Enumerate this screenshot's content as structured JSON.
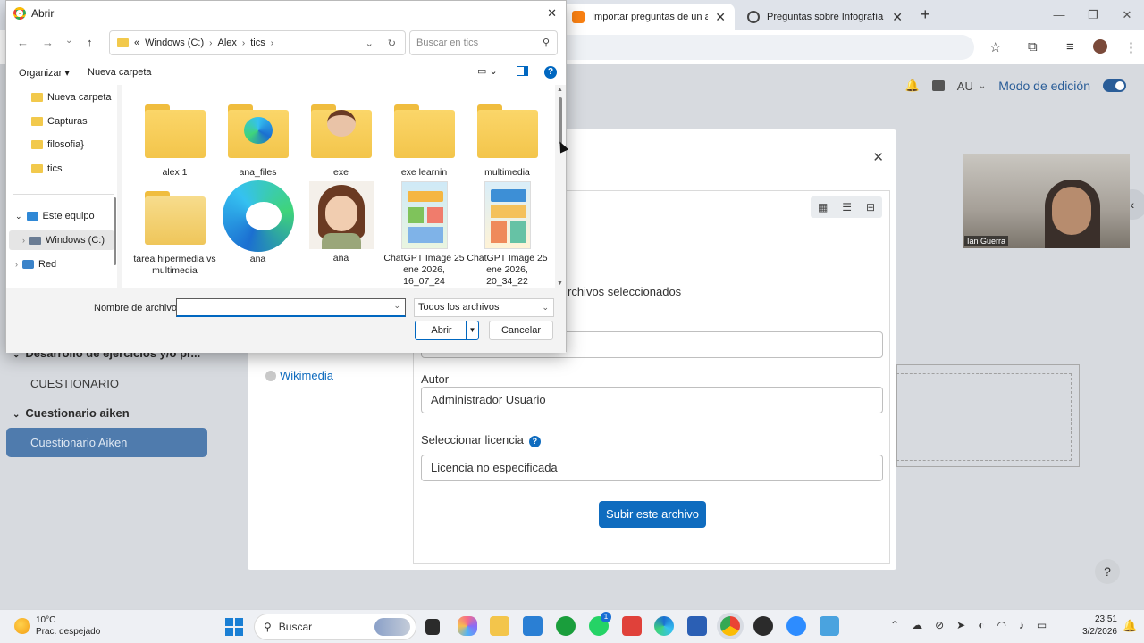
{
  "browser": {
    "tabs": [
      {
        "label": "Importar preguntas de un archi",
        "active": true
      },
      {
        "label": "Preguntas sobre Infografía",
        "active": false
      }
    ],
    "new_tab": "+",
    "window_controls": [
      "—",
      "❐",
      "✕"
    ]
  },
  "moodle": {
    "header": {
      "user_initials": "AU",
      "edit_mode_label": "Modo de edición"
    },
    "nav": {
      "section1": "Desarrollo de ejercicios y/o pr...",
      "item1": "CUESTIONARIO",
      "section2": "Cuestionario aiken",
      "active_item": "Cuestionario Aiken"
    },
    "file_picker": {
      "partial_text": "rchivos seleccionados",
      "repo_wikimedia": "Wikimedia",
      "author_label": "Autor",
      "author_value": "Administrador Usuario",
      "license_label": "Seleccionar licencia",
      "license_help": "?",
      "license_value": "Licencia no especificada",
      "upload_button": "Subir este archivo"
    },
    "video_name": "Ian Guerra",
    "help": "?"
  },
  "dialog": {
    "title": "Abrir",
    "breadcrumb": [
      "«",
      "Windows (C:)",
      "Alex",
      "tics"
    ],
    "search_placeholder": "Buscar en tics",
    "commands": {
      "organize": "Organizar ▾",
      "new_folder": "Nueva carpeta",
      "help": "?"
    },
    "tree": [
      {
        "label": "Nueva carpeta",
        "type": "folder"
      },
      {
        "label": "Capturas",
        "type": "folder"
      },
      {
        "label": "filosofia}",
        "type": "folder"
      },
      {
        "label": "tics",
        "type": "folder"
      },
      {
        "label": "Este equipo",
        "type": "pc"
      },
      {
        "label": "Windows (C:)",
        "type": "drive",
        "selected": true
      },
      {
        "label": "Red",
        "type": "network"
      }
    ],
    "files": [
      {
        "name": "alex 1",
        "kind": "folder"
      },
      {
        "name": "ana_files",
        "kind": "folder-edge"
      },
      {
        "name": "exe",
        "kind": "folder-avatar"
      },
      {
        "name": "exe learnin",
        "kind": "folder"
      },
      {
        "name": "multimedia",
        "kind": "folder"
      },
      {
        "name": "tarea hipermedia vs multimedia",
        "kind": "folder-open"
      },
      {
        "name": "ana",
        "kind": "edge"
      },
      {
        "name": "ana",
        "kind": "avatar"
      },
      {
        "name": "ChatGPT Image 25 ene 2026, 16_07_24",
        "kind": "image"
      },
      {
        "name": "ChatGPT Image 25 ene 2026, 20_34_22",
        "kind": "image"
      }
    ],
    "filename_label": "Nombre de archivo:",
    "filename_value": "",
    "filter_value": "Todos los archivos",
    "open_button": "Abrir",
    "cancel_button": "Cancelar"
  },
  "taskbar": {
    "weather_temp": "10°C",
    "weather_desc": "Prac. despejado",
    "search_label": "Buscar",
    "whatsapp_badge": "1",
    "time": "23:51",
    "date": "3/2/2026"
  }
}
